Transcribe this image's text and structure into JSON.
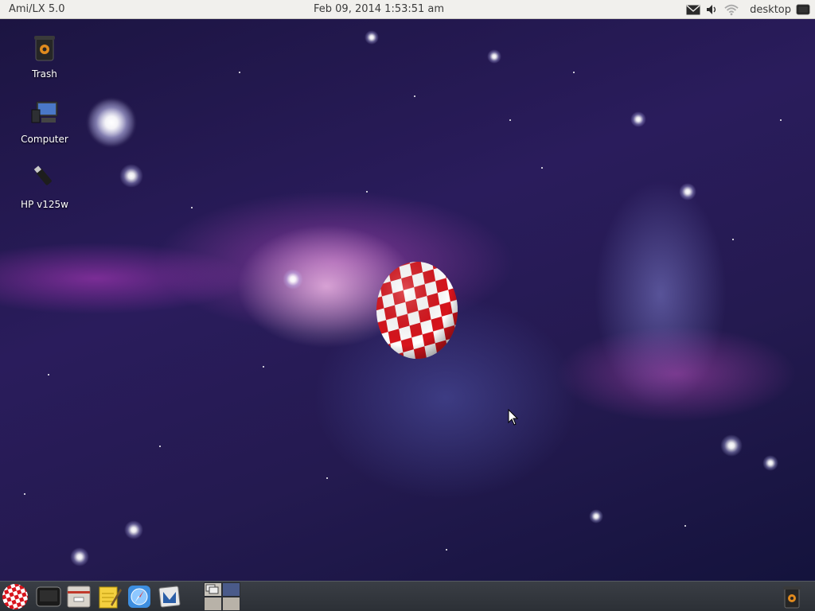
{
  "menubar": {
    "app_title": "Ami/LX 5.0",
    "clock": "Feb 09, 2014  1:53:51 am",
    "workspace_label": "desktop",
    "tray_icons": [
      "mail-icon",
      "volume-icon",
      "wifi-icon",
      "screen-icon"
    ]
  },
  "desktop": {
    "icons": [
      {
        "label": "Trash",
        "icon": "trash-icon"
      },
      {
        "label": "Computer",
        "icon": "computer-icon"
      },
      {
        "label": "HP v125w",
        "icon": "usb-drive-icon"
      }
    ],
    "center_logo": "boing-ball-icon"
  },
  "taskbar": {
    "launchers": [
      "boing-ball-icon",
      "terminal-icon",
      "file-manager-icon",
      "notepad-icon",
      "browser-icon",
      "mail-client-icon"
    ],
    "trash_icon": "trash-icon"
  },
  "colors": {
    "menubar_bg": "#f1f0ed",
    "taskbar_bg": "#2c3036",
    "boing_red": "#d8141c",
    "boing_white": "#ffffff"
  }
}
